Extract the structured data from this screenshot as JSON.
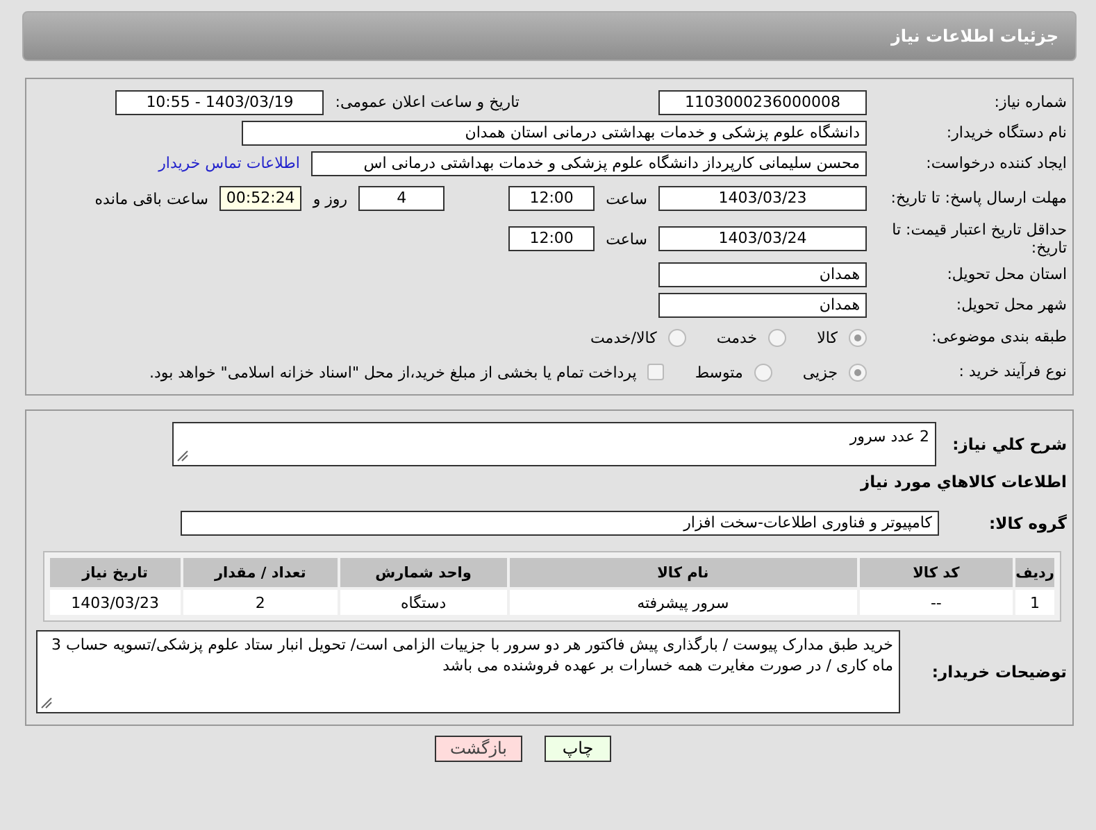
{
  "header": {
    "title": "جزئیات اطلاعات نیاز"
  },
  "general": {
    "need_number": {
      "label": "شماره نیاز:",
      "value": "1103000236000008"
    },
    "announce": {
      "label": "تاریخ و ساعت اعلان عمومی:",
      "value": "1403/03/19 - 10:55"
    },
    "buyer_org": {
      "label": "نام دستگاه خریدار:",
      "value": "دانشگاه علوم پزشکی و خدمات بهداشتی درمانی استان همدان"
    },
    "requester": {
      "label": "ایجاد کننده درخواست:",
      "value": "محسن سلیمانی کارپرداز دانشگاه علوم پزشکی و خدمات بهداشتی درمانی اس",
      "link": "اطلاعات تماس خریدار"
    },
    "reply_deadline": {
      "label": "مهلت ارسال پاسخ: تا تاریخ:",
      "date": "1403/03/23",
      "time_label": "ساعت",
      "time": "12:00",
      "days": "4",
      "days_label": "روز و",
      "remaining": "00:52:24",
      "remaining_label": "ساعت باقی مانده"
    },
    "price_validity": {
      "label": "حداقل تاریخ اعتبار قیمت: تا تاریخ:",
      "date": "1403/03/24",
      "time_label": "ساعت",
      "time": "12:00"
    },
    "province": {
      "label": "استان محل تحویل:",
      "value": "همدان"
    },
    "city": {
      "label": "شهر محل تحویل:",
      "value": "همدان"
    },
    "category": {
      "label": "طبقه بندی موضوعی:",
      "options": [
        {
          "label": "کالا",
          "selected": true
        },
        {
          "label": "خدمت",
          "selected": false
        },
        {
          "label": "کالا/خدمت",
          "selected": false
        }
      ]
    },
    "purchase_type": {
      "label": "نوع فرآیند خرید :",
      "options": [
        {
          "label": "جزیی",
          "selected": true
        },
        {
          "label": "متوسط",
          "selected": false
        }
      ],
      "treasury": {
        "checked": false,
        "text": "پرداخت تمام یا بخشی از مبلغ خرید،از محل \"اسناد خزانه اسلامی\" خواهد بود."
      }
    }
  },
  "needs": {
    "summary": {
      "label": "شرح کلي نياز:",
      "value": "2 عدد سرور"
    },
    "goods_heading": "اطلاعات کالاهاي مورد نياز",
    "goods_group": {
      "label": "گروه کالا:",
      "value": "کامپیوتر و فناوری اطلاعات-سخت افزار"
    },
    "table": {
      "columns": [
        "ردیف",
        "کد کالا",
        "نام کالا",
        "واحد شمارش",
        "تعداد / مقدار",
        "تاریخ نیاز"
      ],
      "rows": [
        [
          "1",
          "--",
          "سرور پیشرفته",
          "دستگاه",
          "2",
          "1403/03/23"
        ]
      ]
    },
    "buyer_notes": {
      "label": "توضیحات خریدار:",
      "value": "خرید طبق مدارک پیوست / بارگذاری  پیش فاکتور هر دو سرور با جزییات الزامی است/ تحویل انبار ستاد  علوم پزشکی/تسویه حساب 3 ماه کاری / در صورت مغایرت همه خسارات بر عهده فروشنده می باشد"
    }
  },
  "buttons": [
    {
      "label": "چاپ",
      "kind": "print"
    },
    {
      "label": "بازگشت",
      "kind": "back"
    }
  ]
}
